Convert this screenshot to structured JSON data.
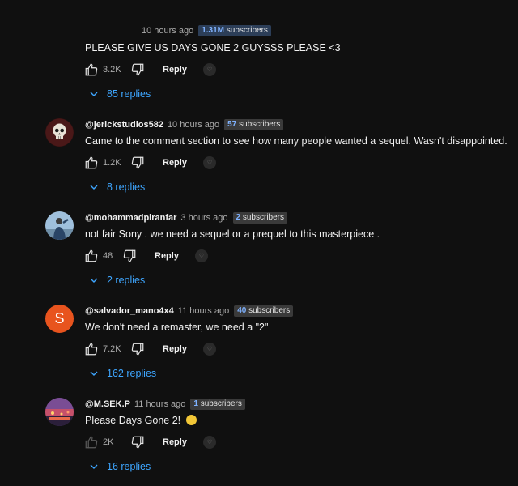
{
  "comments": [
    {
      "handle": "",
      "time": "10 hours ago",
      "subs_num": "1.31M",
      "subs_label": "subscribers",
      "text": "PLEASE GIVE US DAYS GONE 2 GUYSSS PLEASE <3",
      "likes": "3.2K",
      "reply_label": "Reply",
      "replies": "85 replies"
    },
    {
      "handle": "@jerickstudios582",
      "time": "10 hours ago",
      "subs_num": "57",
      "subs_label": "subscribers",
      "text": "Came to the comment section to see how many people wanted a sequel. Wasn't disappointed.",
      "likes": "1.2K",
      "reply_label": "Reply",
      "replies": "8 replies"
    },
    {
      "handle": "@mohammadpiranfar",
      "time": "3 hours ago",
      "subs_num": "2",
      "subs_label": "subscribers",
      "text": "not fair Sony . we need a sequel or a prequel to this masterpiece .",
      "likes": "48",
      "reply_label": "Reply",
      "replies": "2 replies"
    },
    {
      "handle": "@salvador_mano4x4",
      "time": "11 hours ago",
      "subs_num": "40",
      "subs_label": "subscribers",
      "avatar_letter": "S",
      "avatar_color": "#e8541e",
      "text": "We don't need a remaster, we need a \"2\"",
      "likes": "7.2K",
      "reply_label": "Reply",
      "replies": "162 replies"
    },
    {
      "handle": "@M.SEK.P",
      "time": "11 hours ago",
      "subs_num": "1",
      "subs_label": "subscribers",
      "text": "Please Days Gone 2!",
      "likes": "2K",
      "reply_label": "Reply",
      "replies": "16 replies"
    }
  ],
  "colors": {
    "background": "#101010",
    "link_blue": "#3ea6ff",
    "badge_number": "#7fb2ff"
  }
}
